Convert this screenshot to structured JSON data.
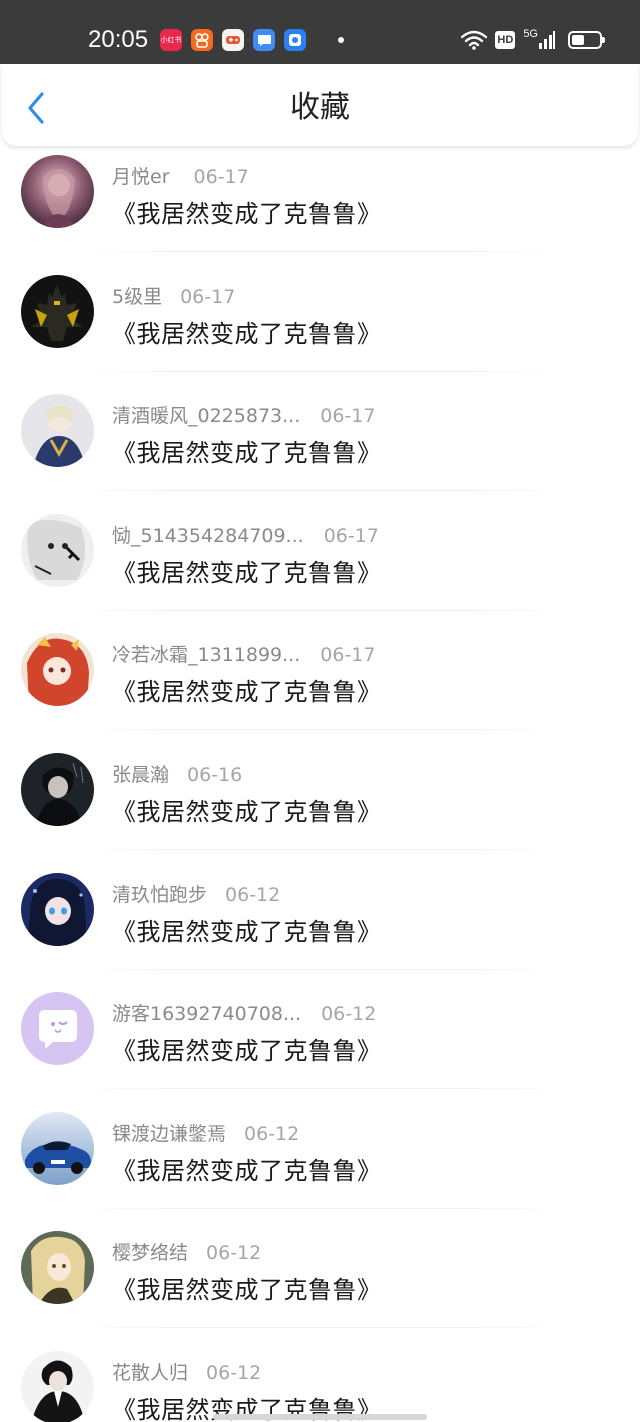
{
  "status_bar": {
    "time": "20:05",
    "apps": [
      {
        "icon": "xiaohongshu-icon",
        "label": "小红书",
        "color": "#e8274a"
      },
      {
        "icon": "kuaishou-icon",
        "label": "",
        "color": "#f26b21"
      },
      {
        "icon": "game-center-icon",
        "label": "",
        "color": "#f4f4f4"
      },
      {
        "icon": "message-icon",
        "label": "",
        "color": "#3f8cf4"
      },
      {
        "icon": "camera-icon",
        "label": "",
        "color": "#2a82f0"
      }
    ],
    "network": "5G",
    "hd": "HD",
    "battery_level": 0.45
  },
  "header": {
    "title": "收藏",
    "back_icon": "chevron-left-icon",
    "accent": "#2f8fe6"
  },
  "items": [
    {
      "name": "月悦er",
      "date": "06-17",
      "content": "《我居然变成了克鲁鲁》",
      "avatar": "anime-girl-pink"
    },
    {
      "name": "5级里",
      "date": "06-17",
      "content": "《我居然变成了克鲁鲁》",
      "avatar": "dark-mecha"
    },
    {
      "name": "清酒暖风_0225873...",
      "date": "06-17",
      "content": "《我居然变成了克鲁鲁》",
      "avatar": "anime-knight"
    },
    {
      "name": "恸_514354284709...",
      "date": "06-17",
      "content": "《我居然变成了克鲁鲁》",
      "avatar": "monochrome-anime"
    },
    {
      "name": "冷若冰霜_1311899...",
      "date": "06-17",
      "content": "《我居然变成了克鲁鲁》",
      "avatar": "anime-redhair"
    },
    {
      "name": "张晨瀚",
      "date": "06-16",
      "content": "《我居然变成了克鲁鲁》",
      "avatar": "dark-boy"
    },
    {
      "name": "清玖怕跑步",
      "date": "06-12",
      "content": "《我居然变成了克鲁鲁》",
      "avatar": "anime-bluegirl"
    },
    {
      "name": "游客16392740708...",
      "date": "06-12",
      "content": "《我居然变成了克鲁鲁》",
      "avatar": "default-chat"
    },
    {
      "name": "锞渡边谦鐅焉",
      "date": "06-12",
      "content": "《我居然变成了克鲁鲁》",
      "avatar": "blue-car"
    },
    {
      "name": "樱梦络结",
      "date": "06-12",
      "content": "《我居然变成了克鲁鲁》",
      "avatar": "anime-blonde"
    },
    {
      "name": "花散人归",
      "date": "06-12",
      "content": "《我居然变成了克鲁鲁》",
      "avatar": "black-suit"
    }
  ]
}
